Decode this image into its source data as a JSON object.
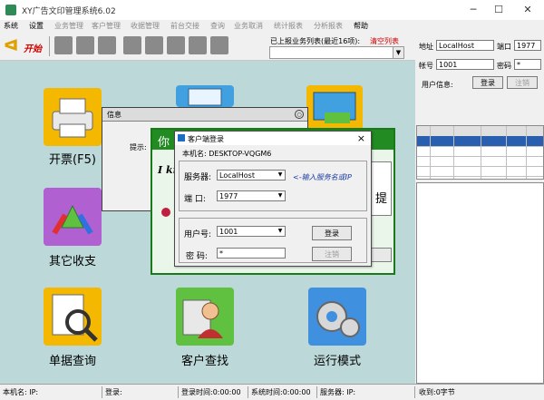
{
  "window": {
    "title": "XY广告文印管理系统6.02",
    "minimize": "─",
    "maximize": "☐",
    "close": "✕"
  },
  "menu": [
    {
      "label": "系统",
      "enabled": true
    },
    {
      "label": "设置",
      "enabled": true
    },
    {
      "label": "业务管理",
      "enabled": false
    },
    {
      "label": "客户管理",
      "enabled": false
    },
    {
      "label": "收据管理",
      "enabled": false
    },
    {
      "label": "前台交接",
      "enabled": false
    },
    {
      "label": "查询",
      "enabled": false
    },
    {
      "label": "业务取消",
      "enabled": false
    },
    {
      "label": "统计报表",
      "enabled": false
    },
    {
      "label": "分析报表",
      "enabled": false
    },
    {
      "label": "帮助",
      "enabled": true
    }
  ],
  "toolbar": {
    "start_glyph": "ᐊ",
    "start_label": "开始",
    "recent_label": "已上报业务列表(最近16项):",
    "clear_label": "清空列表",
    "recent_value": ""
  },
  "tiles": [
    {
      "label": "开票(F5)",
      "icon": "printer-icon",
      "color": "#f5b800"
    },
    {
      "label": "其它收支",
      "icon": "recycle-icon",
      "color": "#b060d0"
    },
    {
      "label": "单据查询",
      "icon": "magnifier-icon",
      "color": "#f5b800"
    },
    {
      "label": "客户查找",
      "icon": "customer-icon",
      "color": "#60c040"
    },
    {
      "label": "运行模式",
      "icon": "gears-icon",
      "color": "#4090e0"
    },
    {
      "label": "",
      "icon": "document-tile-icon",
      "color": "#40a0e0"
    },
    {
      "label": "",
      "icon": "card-tile-icon",
      "color": "#f5b800"
    }
  ],
  "info_dialog": {
    "title": "信息",
    "close_glyph": "○",
    "prompt_label": "提示:"
  },
  "green_card": {
    "header_glyph": "你",
    "body_glyph": "I kn",
    "right_glyph": "提"
  },
  "login": {
    "title": "客户端登录",
    "close": "×",
    "host_label": "本机名:",
    "host_value": "DESKTOP-VQGM6",
    "server_label": "服务器:",
    "server_value": "LocalHost",
    "port_label": "端 口:",
    "port_value": "1977",
    "hint": "<-输入服务名或IP",
    "user_label": "用户号:",
    "user_value": "1001",
    "pwd_label": "密 码:",
    "pwd_value": "*",
    "login_button": "登录",
    "logout_button": "注销"
  },
  "right_panel": {
    "addr_label": "地址",
    "addr_value": "LocalHost",
    "port_label": "端口",
    "port_value": "1977",
    "acct_label": "帐号",
    "acct_value": "1001",
    "pwd_label": "密码",
    "pwd_value": "*",
    "userinfo_label": "用户信息:",
    "login_button": "登录",
    "logout_button": "注销"
  },
  "statusbar": [
    {
      "text": "本机名: IP:"
    },
    {
      "text": "登录:"
    },
    {
      "text": "登录时间:0:00:00"
    },
    {
      "text": "系统时间:0:00:00"
    },
    {
      "text": "服务器: IP:"
    },
    {
      "text": "收到:0字节"
    }
  ]
}
